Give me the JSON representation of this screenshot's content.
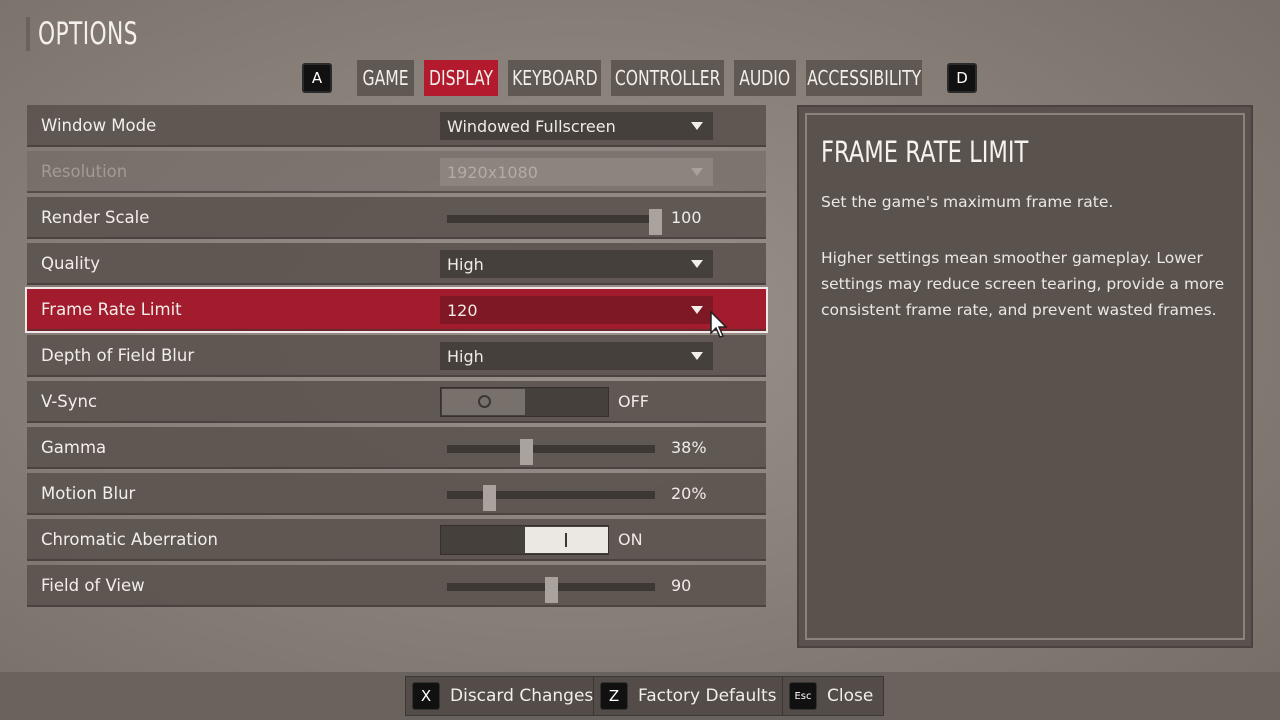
{
  "title": "OPTIONS",
  "tab_nav": {
    "prev_key": "A",
    "next_key": "D"
  },
  "tabs": [
    {
      "label": "GAME",
      "active": false
    },
    {
      "label": "DISPLAY",
      "active": true
    },
    {
      "label": "KEYBOARD",
      "active": false
    },
    {
      "label": "CONTROLLER",
      "active": false
    },
    {
      "label": "AUDIO",
      "active": false
    },
    {
      "label": "ACCESSIBILITY",
      "active": false
    }
  ],
  "settings": {
    "window_mode": {
      "label": "Window Mode",
      "value": "Windowed Fullscreen"
    },
    "resolution": {
      "label": "Resolution",
      "value": "1920x1080",
      "disabled": true
    },
    "render_scale": {
      "label": "Render Scale",
      "value": "100",
      "level": 1.0
    },
    "quality": {
      "label": "Quality",
      "value": "High"
    },
    "frame_rate_limit": {
      "label": "Frame Rate Limit",
      "value": "120",
      "selected": true
    },
    "depth_of_field": {
      "label": "Depth of Field Blur",
      "value": "High"
    },
    "vsync": {
      "label": "V-Sync",
      "value": "OFF",
      "on": false
    },
    "gamma": {
      "label": "Gamma",
      "value": "38%",
      "level": 0.38
    },
    "motion_blur": {
      "label": "Motion Blur",
      "value": "20%",
      "level": 0.2
    },
    "chromatic_aberration": {
      "label": "Chromatic Aberration",
      "value": "ON",
      "on": true
    },
    "field_of_view": {
      "label": "Field of View",
      "value": "90",
      "level": 0.5
    }
  },
  "info": {
    "title": "FRAME RATE LIMIT",
    "p1": "Set the game's maximum frame rate.",
    "p2": "Higher settings mean smoother gameplay. Lower settings may reduce screen tearing, provide a more consistent frame rate, and prevent wasted frames."
  },
  "footer": {
    "discard": {
      "key": "X",
      "label": "Discard Changes"
    },
    "defaults": {
      "key": "Z",
      "label": "Factory Defaults"
    },
    "close": {
      "key": "Esc",
      "label": "Close"
    }
  },
  "colors": {
    "accent": "#b31a2e",
    "panel": "#5c544f",
    "background": "#8a817b"
  }
}
